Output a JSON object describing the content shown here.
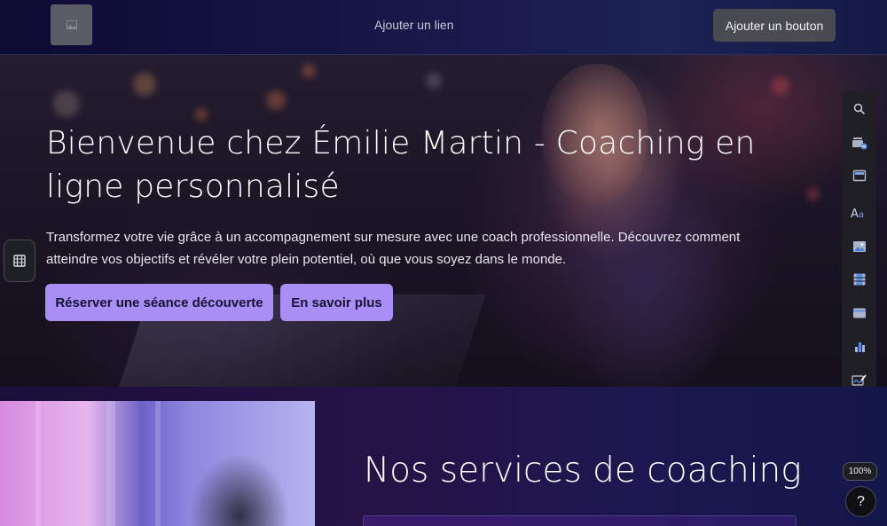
{
  "nav": {
    "add_link_label": "Ajouter un lien",
    "add_button_label": "Ajouter un bouton"
  },
  "hero": {
    "title": "Bienvenue chez Émilie Martin - Coaching en ligne personnalisé",
    "description": "Transformez votre vie grâce à un accompagnement sur mesure avec une coach professionnelle. Découvrez comment atteindre vos objectifs et révéler votre plein potentiel, où que vous soyez dans le monde.",
    "primary_button": "Réserver une séance découverte",
    "secondary_button": "En savoir plus"
  },
  "editor": {
    "toolbar_icons": [
      "search-icon",
      "add-section-icon",
      "layout-icon",
      "text-icon",
      "image-icon",
      "video-icon",
      "card-icon",
      "chart-icon",
      "signature-icon"
    ],
    "left_tool_icon": "film-icon",
    "zoom": "100%",
    "help": "?"
  },
  "services": {
    "title": "Nos services de coaching"
  },
  "colors": {
    "accent": "#a98ef5",
    "nav_bg": "#171748",
    "toolbar_bg": "#1e1e24"
  }
}
